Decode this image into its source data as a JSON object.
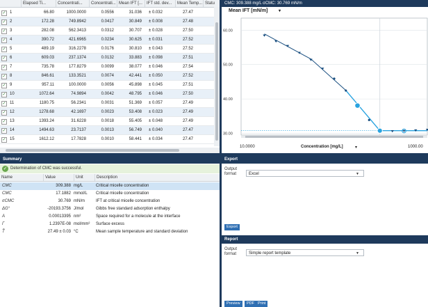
{
  "table": {
    "columns": [
      "",
      "Elapsed Ti...",
      "Concentrati...",
      "Concentrati...",
      "Mean IFT [...",
      "IFT std. dev...",
      "Mean Temp...",
      "Statu"
    ],
    "rows": [
      {
        "n": "1",
        "elapsed": "66.80",
        "conc1": "1000.0000",
        "conc2": "0.0556",
        "ift": "31.036",
        "sd": "± 0.032",
        "temp": "27.47"
      },
      {
        "n": "2",
        "elapsed": "172.28",
        "conc1": "749.8942",
        "conc2": "0.0417",
        "ift": "30.849",
        "sd": "± 0.008",
        "temp": "27.48"
      },
      {
        "n": "3",
        "elapsed": "282.08",
        "conc1": "562.3413",
        "conc2": "0.0312",
        "ift": "30.707",
        "sd": "± 0.028",
        "temp": "27.50"
      },
      {
        "n": "4",
        "elapsed": "390.72",
        "conc1": "421.6965",
        "conc2": "0.0234",
        "ift": "30.625",
        "sd": "± 0.031",
        "temp": "27.52"
      },
      {
        "n": "5",
        "elapsed": "489.19",
        "conc1": "316.2278",
        "conc2": "0.0176",
        "ift": "30.810",
        "sd": "± 0.043",
        "temp": "27.52"
      },
      {
        "n": "6",
        "elapsed": "609.03",
        "conc1": "237.1374",
        "conc2": "0.0132",
        "ift": "33.883",
        "sd": "± 0.098",
        "temp": "27.51"
      },
      {
        "n": "7",
        "elapsed": "735.78",
        "conc1": "177.8279",
        "conc2": "0.0099",
        "ift": "38.077",
        "sd": "± 0.046",
        "temp": "27.54"
      },
      {
        "n": "8",
        "elapsed": "846.61",
        "conc1": "133.3521",
        "conc2": "0.0074",
        "ift": "42.441",
        "sd": "± 0.050",
        "temp": "27.52"
      },
      {
        "n": "9",
        "elapsed": "957.11",
        "conc1": "100.0000",
        "conc2": "0.0056",
        "ift": "45.898",
        "sd": "± 0.045",
        "temp": "27.51"
      },
      {
        "n": "10",
        "elapsed": "1072.64",
        "conc1": "74.9894",
        "conc2": "0.0042",
        "ift": "48.795",
        "sd": "± 0.046",
        "temp": "27.50"
      },
      {
        "n": "11",
        "elapsed": "1180.75",
        "conc1": "56.2341",
        "conc2": "0.0031",
        "ift": "51.369",
        "sd": "± 0.057",
        "temp": "27.49"
      },
      {
        "n": "12",
        "elapsed": "1278.68",
        "conc1": "42.1697",
        "conc2": "0.0023",
        "ift": "53.408",
        "sd": "± 0.023",
        "temp": "27.49"
      },
      {
        "n": "13",
        "elapsed": "1393.24",
        "conc1": "31.6228",
        "conc2": "0.0018",
        "ift": "55.405",
        "sd": "± 0.048",
        "temp": "27.49"
      },
      {
        "n": "14",
        "elapsed": "1494.63",
        "conc1": "23.7137",
        "conc2": "0.0013",
        "ift": "56.749",
        "sd": "± 0.040",
        "temp": "27.47"
      },
      {
        "n": "15",
        "elapsed": "1612.12",
        "conc1": "17.7828",
        "conc2": "0.0010",
        "ift": "58.441",
        "sd": "± 0.034",
        "temp": "27.47"
      }
    ],
    "check_mark": "✓"
  },
  "chart_header": "CMC: 309.388 mg/L   σCMC: 30.769 mN/m",
  "chart_data": {
    "type": "line",
    "title": "",
    "ylabel": "Mean IFT [mN/m]",
    "xlabel": "Concentration [mg/L]",
    "x_scale": "log",
    "xlim": [
      10,
      1000
    ],
    "ylim": [
      29.5,
      63.5
    ],
    "y_ticks": [
      "60.00",
      "50.00",
      "40.00",
      "30.00"
    ],
    "x_ticks": [
      "10.0000",
      "1000.00"
    ],
    "series": [
      {
        "name": "",
        "x": [
          17.7828,
          23.7137,
          31.6228,
          42.1697,
          56.2341,
          74.9894,
          100,
          133.3521,
          177.8279,
          237.1374,
          316.2278,
          421.6965,
          562.3413,
          749.8942,
          1000
        ],
        "y": [
          58.441,
          56.749,
          55.405,
          53.408,
          51.369,
          48.795,
          45.898,
          42.441,
          38.077,
          33.883,
          30.81,
          30.625,
          30.707,
          30.849,
          31.036
        ]
      }
    ],
    "cmc": 309.388,
    "highlight_color": "#29a3e0",
    "line_color": "#1a4f80"
  },
  "chart_labels": {
    "ylabel": "Mean IFT [mN/m]",
    "xlabel": "Concentration [mg/L]",
    "ymax": "60.00",
    "ymid": "50.00",
    "y40": "40.00",
    "y30": "30.00",
    "xmin": "10.0000",
    "xmax": "1000.00",
    "dropdown": "▾"
  },
  "summary": {
    "title": "Summary",
    "success_message": "Determination of CMC was successful.",
    "check_icon": "✓",
    "columns": [
      "Name",
      "Value",
      "Unit",
      "Description"
    ],
    "rows": [
      {
        "name": "CMC",
        "value": "309.388",
        "unit": "mg/L",
        "desc": "Critical micelle concentration"
      },
      {
        "name": "CMC",
        "value": "17.1882",
        "unit": "mmol/L",
        "desc": "Critical micelle concentration"
      },
      {
        "name": "σCMC",
        "value": "30.769",
        "unit": "mN/m",
        "desc": "IFT at critical micelle concentration"
      },
      {
        "name": "ΔG°",
        "value": "-20193.3756",
        "unit": "J/mol",
        "desc": "Gibbs free standard adsorption enthalpy"
      },
      {
        "name": "A",
        "value": "0.00013395",
        "unit": "nm²",
        "desc": "Space required for a molecule at the interface"
      },
      {
        "name": "Γ",
        "value": "1.2397E-08",
        "unit": "mol/mm²",
        "desc": "Surface excess"
      },
      {
        "name": "T̄",
        "value": "27.49 ± 0.03",
        "unit": "°C",
        "desc": "Mean sample temperature and standard deviation"
      }
    ]
  },
  "export": {
    "title": "Export",
    "format_label": "Output format",
    "format_value": "Excel",
    "button": "Export"
  },
  "report": {
    "title": "Report",
    "format_label": "Output format",
    "format_value": "Simple report template",
    "buttons": [
      "Preview",
      "PDF",
      "Print"
    ]
  }
}
